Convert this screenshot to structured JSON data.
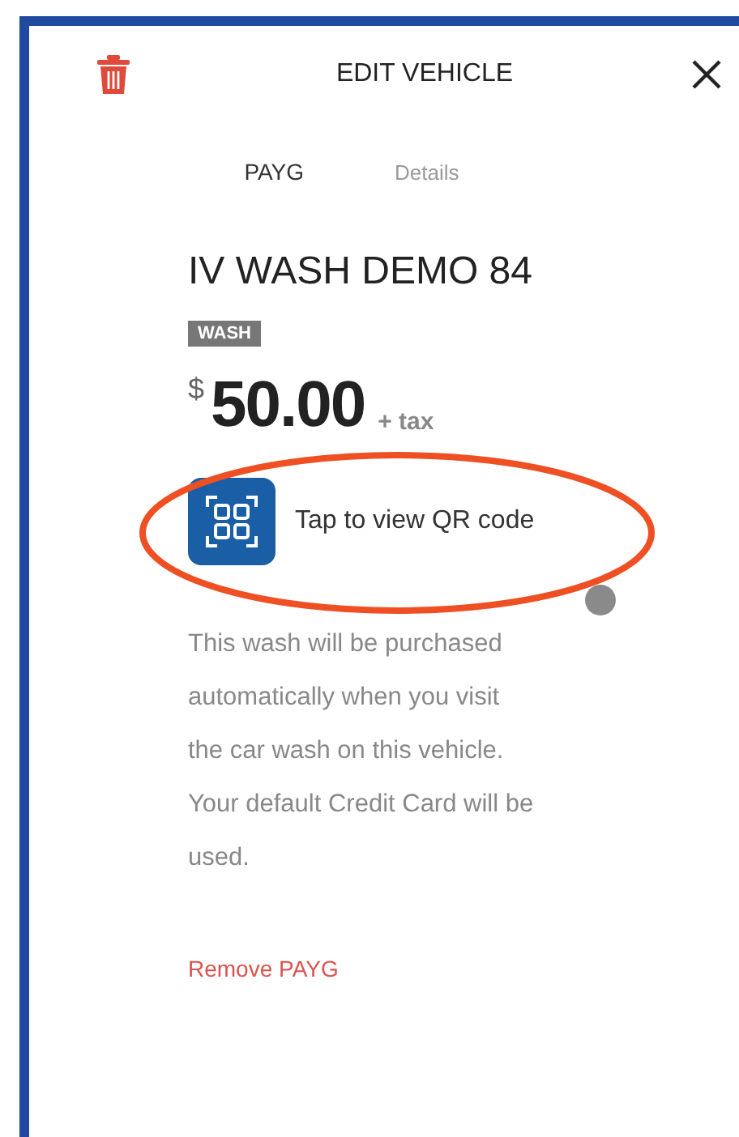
{
  "header": {
    "title": "EDIT VEHICLE"
  },
  "tabs": [
    {
      "label": "PAYG",
      "selected": true
    },
    {
      "label": "Details",
      "selected": false
    }
  ],
  "vehicle": {
    "name": "IV WASH DEMO 84",
    "tag": "WASH"
  },
  "price": {
    "currency": "$",
    "amount": "50.00",
    "suffix": "+ tax"
  },
  "qr_button": {
    "label": "Tap to view QR code"
  },
  "description": "This wash will be purchased automatically when you visit the car wash on this vehicle. Your default Credit Card will be used.",
  "remove_link": "Remove PAYG"
}
